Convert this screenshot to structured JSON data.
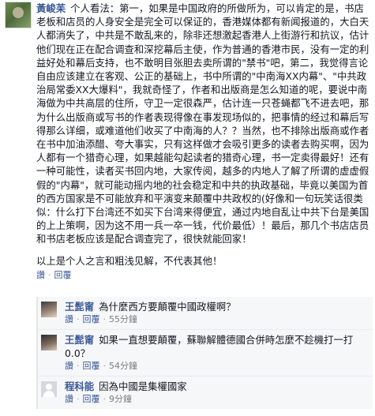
{
  "comment": {
    "author": "黃峻苿",
    "text": "个人看法：第一，如果是中国政府的所做所为，可以肯定的是，书店老板和店员的人身安全是完全可以保证的，香港媒体都有新闻报道的，大白天人都消失了，中共是不敢乱来的，除非还想激起香港人上街游行和抗议，估计他们现在正在配合调查和深挖幕后主使，作为普通的香港市民，没有一定的利益好处和幕后支持，也不敢明目张胆去卖所谓的\"禁书\"吧，第二，我觉得言论自由应该建立在客观、公正的基础上，书中所谓的\"中南海XX内幕\"、\"中共政治局常委XX大爆料\"，我就奇怪了，作者和出版商是怎么知道的呢，要说中南海做为中共高层的住所，守卫一定很森严，估计连一只苍蝇都飞不进去吧，那为什么出版商或写书的作者表现得像在事发现场似的，把事情的经过和幕后写得那么详细，或难道他们收买了中南海的人？？当然，也不排除出版商或作者在书中加油添醋、夸大事实，只有这样做才会吸引更多的读者去购买啊，因为人都有一个猎奇心理，如果越能勾起读者的猎奇心理，书一定卖得最好！还有一种可能性，读者买书回内地，大家传阅，越多的内地人了解了所谓的虚虚假假的\"内幕\"，就可能动摇内地的社会稳定和中共的执政基础，毕竟以美国为首的西方国家是不可能放弃和平演变来颠覆中共政权的(好像和一句玩笑话很类似：什么打下台湾还不如买下台湾来得便宜，通过内地自乱让中共下台是美国的上上策啊，因为这不用一兵一卒一钱，代价最低）！最后，那几个书店店员和书店老板应该是配合调查完了，很快就能回家！",
    "closing": "以上是个人之言和粗浅见解，不代表其他！",
    "actions": {
      "like": "讚",
      "reply": "回覆",
      "time": ""
    }
  },
  "replies": [
    {
      "author": "王髭甯",
      "text": "為什麼西方要顛覆中國政權啊？",
      "actions": {
        "like": "讚",
        "reply": "回覆",
        "time": "55分鐘"
      }
    },
    {
      "author": "王髭甯",
      "text": "如果一直想要顛覆，蘇聯解體德國合併時怎麼不趁機打一打0.0？",
      "actions": {
        "like": "讚",
        "reply": "回覆",
        "time": "54分鐘"
      }
    },
    {
      "author": "程科能",
      "text": "因為中國是集權國家",
      "actions": {
        "like": "讚",
        "reply": "回覆",
        "time": "9分鐘"
      }
    }
  ]
}
